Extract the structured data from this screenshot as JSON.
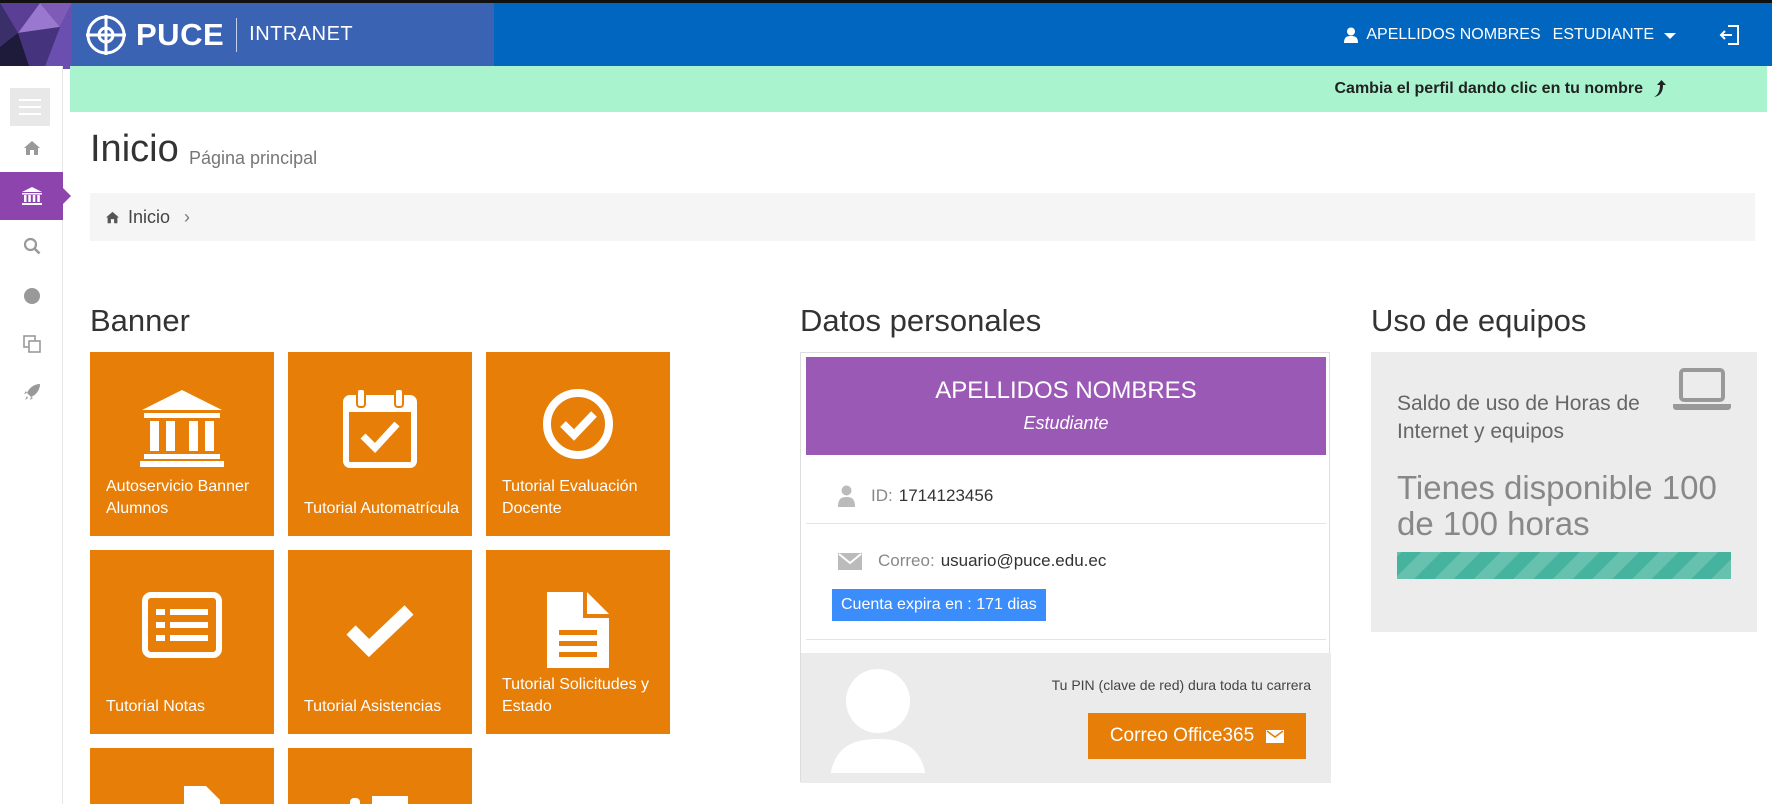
{
  "header": {
    "brand": "PUCE",
    "subtitle": "INTRANET",
    "user_name": "APELLIDOS NOMBRES",
    "user_role": "ESTUDIANTE",
    "brand_color": "#3a63b4",
    "bar_color": "#0066c0"
  },
  "notice": {
    "text": "Cambia el perfil dando clic en tu nombre",
    "color": "#a9f4cf"
  },
  "sidebar": {
    "items": [
      {
        "icon": "home-icon"
      },
      {
        "icon": "bank-icon",
        "active": true
      },
      {
        "icon": "search-icon"
      },
      {
        "icon": "circle-icon"
      },
      {
        "icon": "copy-icon"
      },
      {
        "icon": "rocket-icon"
      }
    ],
    "active_color": "#8e44ad"
  },
  "page": {
    "title": "Inicio",
    "subtitle": "Página principal",
    "breadcrumb": "Inicio"
  },
  "banner": {
    "title": "Banner",
    "tile_color": "#e67e08",
    "tiles": [
      {
        "label": "Autoservicio Banner Alumnos",
        "icon": "bank-icon"
      },
      {
        "label": "Tutorial Automatrícula",
        "icon": "calendar-check-icon"
      },
      {
        "label": "Tutorial Evaluación Docente",
        "icon": "check-circle-icon"
      },
      {
        "label": "Tutorial Notas",
        "icon": "list-alt-icon"
      },
      {
        "label": "Tutorial Asistencias",
        "icon": "checkmark-icon"
      },
      {
        "label": "Tutorial Solicitudes y Estado",
        "icon": "document-icon"
      }
    ]
  },
  "datos": {
    "title": "Datos personales",
    "name": "APELLIDOS NOMBRES",
    "role": "Estudiante",
    "id_label": "ID:",
    "id_value": "1714123456",
    "email_label": "Correo:",
    "email_value": "usuario@puce.edu.ec",
    "expire_text": "Cuenta expira en : 171 dias",
    "pin_text": "Tu PIN (clave de red) dura toda tu carrera",
    "office_button": "Correo Office365",
    "header_color": "#9b59b6",
    "badge_color": "#3c8dfc"
  },
  "equipos": {
    "title": "Uso de equipos",
    "description": "Saldo de uso de Horas de Internet y equipos",
    "available": "Tienes disponible 100 de 100 horas",
    "usage_percent": 100,
    "bar_color": "#45b39d"
  }
}
